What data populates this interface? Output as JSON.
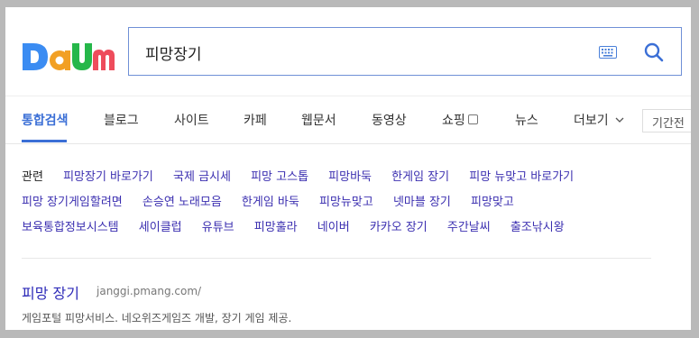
{
  "brand": {
    "logo_text": "Daum"
  },
  "search": {
    "query": "피망장기",
    "keyboard_icon": "keyboard-icon",
    "search_icon": "magnifier-icon",
    "accent_color": "#3b6fd6"
  },
  "tabs": {
    "items": [
      {
        "label": "통합검색",
        "active": true
      },
      {
        "label": "블로그"
      },
      {
        "label": "사이트"
      },
      {
        "label": "카페"
      },
      {
        "label": "웹문서"
      },
      {
        "label": "동영상"
      },
      {
        "label": "쇼핑"
      },
      {
        "label": "뉴스"
      },
      {
        "label": "더보기"
      }
    ],
    "period_label": "기간전"
  },
  "related": {
    "label": "관련",
    "links": [
      "피망장기 바로가기",
      "국제 금시세",
      "피망 고스톱",
      "피망바둑",
      "한게임 장기",
      "피망 뉴맞고 바로가기",
      "피망 장기게임할려면",
      "손승연 노래모음",
      "한게임 바둑",
      "피망뉴맞고",
      "넷마블 장기",
      "피망맞고",
      "보육통합정보시스템",
      "세이클럽",
      "유튜브",
      "피망훌라",
      "네이버",
      "카카오 장기",
      "주간날씨",
      "출조낚시왕"
    ]
  },
  "result": {
    "title": "피망 장기",
    "url": "janggi.pmang.com/",
    "description": "게임포털 피망서비스. 네오위즈게임즈 개발, 장기 게임 제공."
  }
}
